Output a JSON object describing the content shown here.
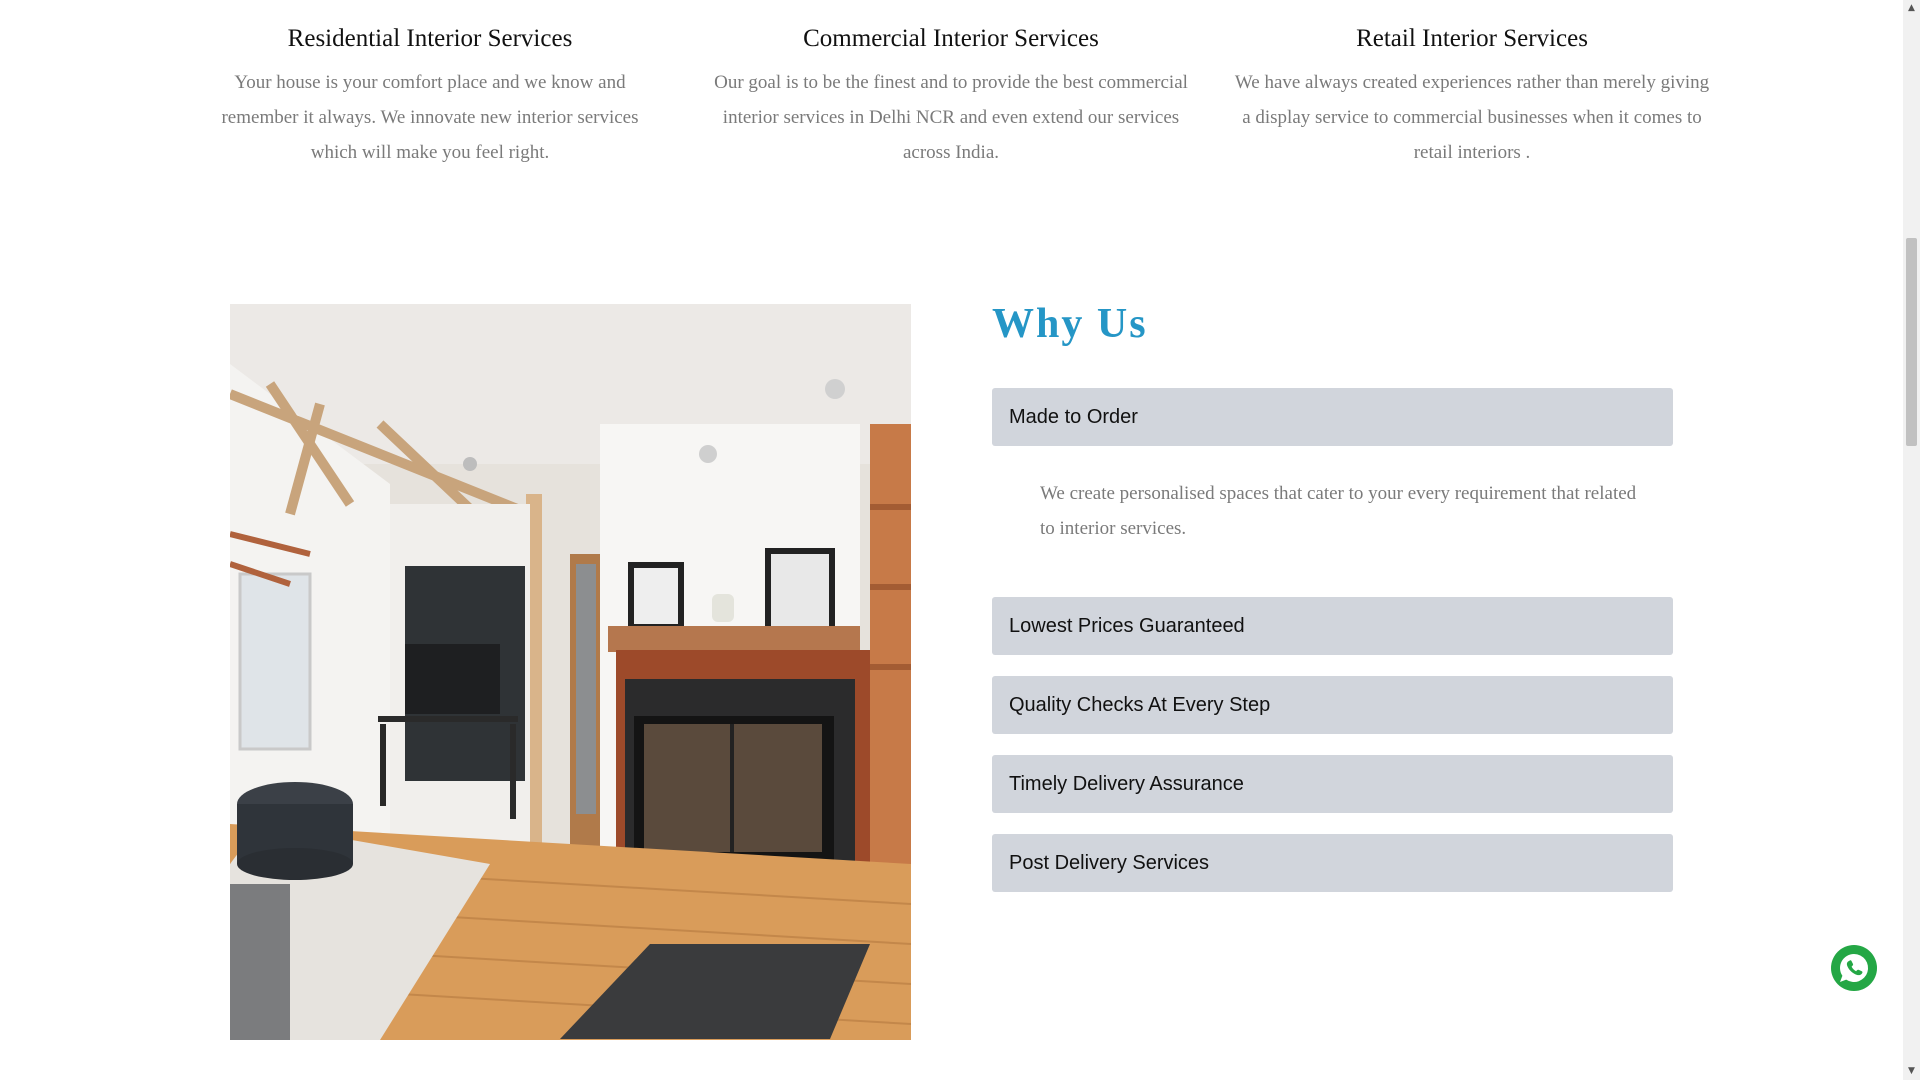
{
  "services": [
    {
      "title": "Residential Interior Services",
      "description": "Your house is your comfort place and we know and remember it always. We innovate new interior services which will make you feel right."
    },
    {
      "title": "Commercial Interior Services",
      "description": "Our goal is to be the finest and to provide the best commercial interior services in Delhi NCR and even extend our services across India."
    },
    {
      "title": "Retail Interior Services",
      "description": "We have always created experiences rather than merely giving a display service to commercial businesses when it comes to retail interiors ."
    }
  ],
  "why_us": {
    "title": "Why Us",
    "items": [
      {
        "label": "Made to Order",
        "expanded": true,
        "body": "We create personalised spaces that cater to your every requirement that related to interior services."
      },
      {
        "label": "Lowest Prices Guaranteed",
        "expanded": false
      },
      {
        "label": "Quality Checks At Every Step",
        "expanded": false
      },
      {
        "label": "Timely Delivery Assurance",
        "expanded": false
      },
      {
        "label": "Post Delivery Services",
        "expanded": false
      }
    ]
  },
  "colors": {
    "accent": "#2596c6",
    "accordion_bg": "#d1d5dc",
    "body_text": "#7a7a7a",
    "whatsapp": "#24a745"
  },
  "icons": {
    "floating_button": "whatsapp-icon",
    "scroll_up": "scroll-up-arrow",
    "scroll_down": "scroll-down-arrow"
  }
}
